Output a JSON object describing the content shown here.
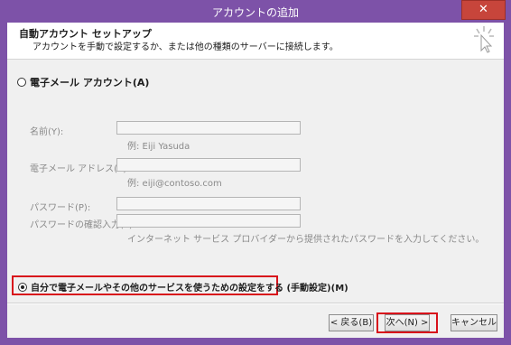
{
  "window": {
    "title": "アカウントの追加",
    "close_glyph": "✕"
  },
  "header": {
    "title": "自動アカウント セットアップ",
    "description": "アカウントを手動で設定するか、または他の種類のサーバーに接続します。",
    "icon": "wizard-sparkle-icon"
  },
  "options": {
    "email_account": "電子メール アカウント(A)",
    "manual_setup": "自分で電子メールやその他のサービスを使うための設定をする (手動設定)(M)",
    "selected": "manual_setup"
  },
  "fields": {
    "name_label": "名前(Y):",
    "name_hint": "例: Eiji Yasuda",
    "email_label": "電子メール アドレス(E):",
    "email_hint": "例: eiji@contoso.com",
    "password_label": "パスワード(P):",
    "password_confirm_label": "パスワードの確認入力(T):",
    "password_hint": "インターネット サービス プロバイダーから提供されたパスワードを入力してください。"
  },
  "buttons": {
    "back": "< 戻る(B)",
    "next": "次へ(N) >",
    "cancel": "キャンセル"
  },
  "colors": {
    "title_bar": "#7d52a8",
    "highlight": "#d8121b",
    "close_button": "#c7453b"
  }
}
